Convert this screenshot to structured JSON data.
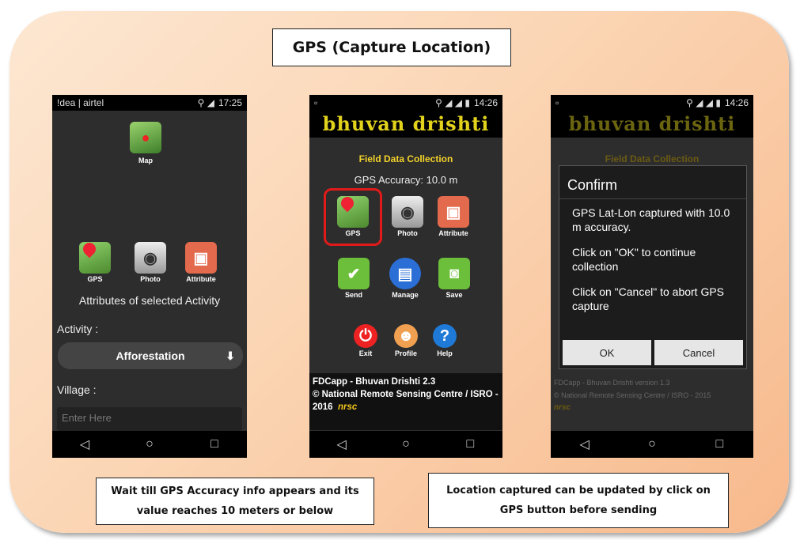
{
  "title": "GPS (Capture Location)",
  "phone1": {
    "status_left": "!dea | airtel",
    "status_right": "17:25",
    "map_label": "Map",
    "gps_label": "GPS",
    "photo_label": "Photo",
    "attribute_label": "Attribute",
    "section_title": "Attributes of selected Activity",
    "activity_label": "Activity :",
    "activity_value": "Afforestation",
    "village_label": "Village :",
    "village_placeholder": "Enter Here"
  },
  "phone2": {
    "status_right": "14:26",
    "app_header": "bhuvan drishti",
    "subtitle": "Field Data Collection",
    "gps_accuracy": "GPS Accuracy: 10.0 m",
    "gps_label": "GPS",
    "photo_label": "Photo",
    "attribute_label": "Attribute",
    "send_label": "Send",
    "manage_label": "Manage",
    "save_label": "Save",
    "exit_label": "Exit",
    "profile_label": "Profile",
    "help_label": "Help",
    "footer_line1": "FDCapp - Bhuvan Drishti 2.3",
    "footer_line2": "© National Remote Sensing Centre / ISRO -",
    "footer_year": "2016",
    "footer_logo": "nrsc"
  },
  "phone3": {
    "status_right": "14:26",
    "app_header": "bhuvan drishti",
    "subtitle": "Field Data Collection",
    "dialog_title": "Confirm",
    "dialog_msg1": "GPS Lat-Lon captured with 10.0 m accuracy.",
    "dialog_msg2": "Click on \"OK\" to continue collection",
    "dialog_msg3": "Click on \"Cancel\" to abort GPS capture",
    "ok_label": "OK",
    "cancel_label": "Cancel",
    "footer_line1": "FDCapp - Bhuvan Drishti version 1.3",
    "footer_line2": "© National Remote Sensing Centre / ISRO - 2015",
    "footer_logo": "nrsc"
  },
  "nav": {
    "back": "◁",
    "home": "○",
    "recent": "□"
  },
  "note_left": "Wait till GPS Accuracy info appears and its value reaches 10 meters or below",
  "note_right": "Location captured can be updated by click on GPS button before sending"
}
